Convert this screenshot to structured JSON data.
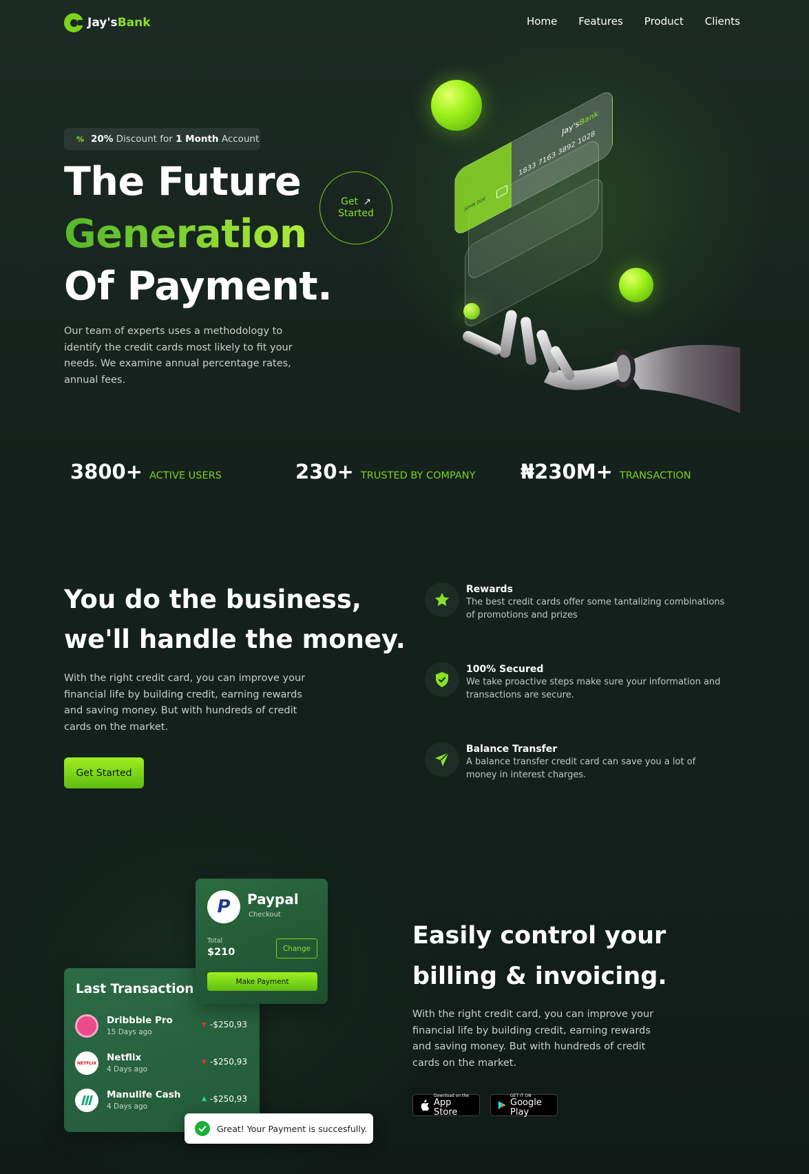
{
  "nav": {
    "logo_prefix": "Jay's",
    "logo_suffix": "Bank",
    "links": [
      "Home",
      "Features",
      "Product",
      "Clients"
    ]
  },
  "hero": {
    "promo_icon": "%",
    "promo_pct": "20%",
    "promo_mid": " Discount for ",
    "promo_bold": "1 Month",
    "promo_end": " Account",
    "title_line1": "The Future",
    "title_line2": "Generation",
    "title_line3": "Of Payment.",
    "description": "Our team of experts uses a methodology to identify the credit cards most likely to fit your needs. We examine annual percentage rates, annual fees.",
    "cta_line1": "Get",
    "cta_line2": "Started",
    "card_number": "1833 7163 3892 1028",
    "card_brand_prefix": "Jay's",
    "card_brand_suffix": "Bank",
    "card_holder": "JOHN DOE"
  },
  "stats": [
    {
      "value": "3800+",
      "label": "ACTIVE USERS"
    },
    {
      "value": "230+",
      "label": "TRUSTED BY COMPANY"
    },
    {
      "value": "₦230M+",
      "label": "TRANSACTION"
    }
  ],
  "business": {
    "title_line1": "You do the business,",
    "title_line2": "we'll handle the money.",
    "description": "With the right credit card, you can improve your financial life by building credit, earning rewards and saving money. But with hundreds of credit cards on the market.",
    "button": "Get Started",
    "features": [
      {
        "icon": "star-icon",
        "title": "Rewards",
        "desc": "The best credit cards offer some tantalizing combinations of promotions and prizes"
      },
      {
        "icon": "shield-icon",
        "title": "100% Secured",
        "desc": "We take proactive steps make sure your information and transactions are secure."
      },
      {
        "icon": "paper-plane-icon",
        "title": "Balance Transfer",
        "desc": "A balance transfer credit card can save you a lot of money in interest charges."
      }
    ]
  },
  "billing": {
    "paypal": {
      "name": "Paypal",
      "sub": "Checkout",
      "total_label": "Total",
      "total_value": "$210",
      "change": "Change",
      "pay_button": "Make Payment"
    },
    "last_transaction": {
      "title": "Last Transaction",
      "items": [
        {
          "name": "Dribbble Pro",
          "time": "15 Days ago",
          "amount": "-$250,93",
          "direction": "down"
        },
        {
          "name": "Netflix",
          "time": "4 Days ago",
          "amount": "-$250,93",
          "direction": "down"
        },
        {
          "name": "Manulife Cash",
          "time": "4 Days ago",
          "amount": "-$250,93",
          "direction": "up"
        }
      ]
    },
    "toast": "Great! Your Payment is succesfully.",
    "title_line1": "Easily control your",
    "title_line2": "billing & invoicing.",
    "description": "With the right credit card, you can improve your financial life by building credit, earning rewards and saving money. But with hundreds of credit cards on the market.",
    "appstore_small": "Download on the",
    "appstore_big": "App Store",
    "googleplay_small": "GET IT ON",
    "googleplay_big": "Google Play"
  },
  "colors": {
    "accent": "#8be02a",
    "bg": "#16231d",
    "down": "#d63b3b",
    "up": "#2fd4a0"
  }
}
